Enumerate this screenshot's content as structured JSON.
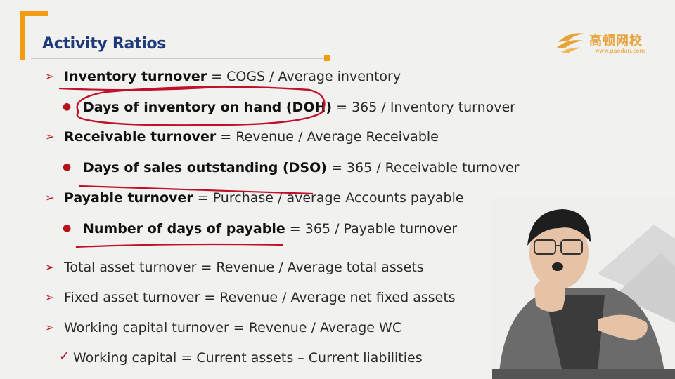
{
  "header": {
    "title": "Activity Ratios",
    "logo_cn": "高顿网校",
    "logo_url": "www.gaodun.com"
  },
  "lines": [
    {
      "kind": "arrow",
      "term": "Inventory turnover",
      "formula": " = COGS / Average inventory"
    },
    {
      "kind": "bullet",
      "term": "Days of inventory on hand (DOH)",
      "formula": " = 365 / Inventory turnover"
    },
    {
      "kind": "arrow",
      "term": "Receivable turnover",
      "formula": " = Revenue / Average Receivable"
    },
    {
      "kind": "bullet",
      "term": "Days of sales outstanding (DSO)",
      "formula": " = 365 / Receivable turnover"
    },
    {
      "kind": "arrow",
      "term": "Payable turnover",
      "formula": " = Purchase / average Accounts payable"
    },
    {
      "kind": "bullet",
      "term": "Number of days of payable",
      "formula": " = 365 / Payable turnover"
    },
    {
      "kind": "arrow",
      "term": "",
      "formula": "Total asset turnover = Revenue / Average total assets"
    },
    {
      "kind": "arrow",
      "term": "",
      "formula": "Fixed asset turnover = Revenue / Average net fixed assets"
    },
    {
      "kind": "arrow",
      "term": "",
      "formula": "Working capital turnover = Revenue / Average WC"
    },
    {
      "kind": "check",
      "term": "",
      "formula": "Working capital = Current assets – Current liabilities"
    }
  ],
  "colors": {
    "accent": "#f39c12",
    "title": "#1f3a7a",
    "marker": "#b5121b",
    "ink": "#c0102a"
  }
}
